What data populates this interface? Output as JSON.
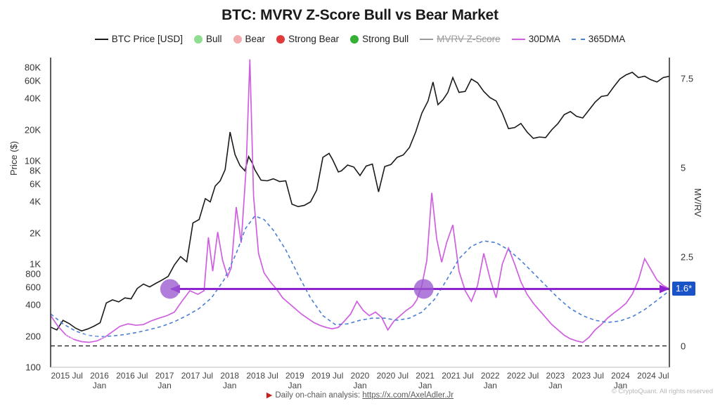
{
  "title": "BTC: MVRV Z-Score Bull vs Bear Market",
  "axis": {
    "left_label": "Price ($)",
    "right_label": "MV/RV",
    "left_ticks": [
      "80K",
      "60K",
      "40K",
      "20K",
      "10K",
      "8K",
      "6K",
      "4K",
      "2K",
      "1K",
      "800",
      "600",
      "400",
      "200",
      "100"
    ],
    "right_ticks": [
      "7.5",
      "5",
      "2.5",
      "0"
    ],
    "x_ticks": [
      "2015 Jul",
      "2016\nJan",
      "2016 Jul",
      "2017\nJan",
      "2017 Jul",
      "2018\nJan",
      "2018 Jul",
      "2019\nJan",
      "2019 Jul",
      "2020\nJan",
      "2020 Jul",
      "2021\nJan",
      "2021 Jul",
      "2022\nJan",
      "2022 Jul",
      "2023\nJan",
      "2023 Jul",
      "2024\nJan",
      "2024 Jul"
    ]
  },
  "legend": [
    {
      "label": "BTC Price [USD]",
      "marker": "line",
      "color": "#1a1a1a",
      "disabled": false
    },
    {
      "label": "Bull",
      "marker": "dot",
      "color": "#90dd90",
      "disabled": false
    },
    {
      "label": "Bear",
      "marker": "dot",
      "color": "#f2aaaa",
      "disabled": false
    },
    {
      "label": "Strong Bear",
      "marker": "dot",
      "color": "#e03a3a",
      "disabled": false
    },
    {
      "label": "Strong Bull",
      "marker": "dot",
      "color": "#35b035",
      "disabled": false
    },
    {
      "label": "MVRV Z-Score",
      "marker": "line",
      "color": "#9a9a9a",
      "disabled": true
    },
    {
      "label": "30DMA",
      "marker": "line",
      "color": "#cf5fe0",
      "disabled": false
    },
    {
      "label": "365DMA",
      "marker": "dash",
      "color": "#4a7fd4",
      "disabled": false
    }
  ],
  "annotations": {
    "current_value_badge": "1.6*",
    "badge_color": "#1a52c8",
    "arrow_color": "#8e24cf",
    "circles": [
      {
        "x_frac": 0.193,
        "value_label": ""
      },
      {
        "x_frac": 0.603,
        "value_label": ""
      }
    ]
  },
  "watermark": "CryptoQuant",
  "footer": {
    "prefix": "Daily on-chain analysis:",
    "link": "https://x.com/AxelAdler.Jr",
    "copyright": "© CryptoQuant. All rights reserved"
  },
  "chart_data": {
    "type": "line",
    "title": "BTC: MVRV Z-Score Bull vs Bear Market",
    "subtitle": "",
    "xlabel": "",
    "ylabel": "Price ($)",
    "y2label": "MV/RV",
    "yscale": "log",
    "ylim": [
      100,
      100000
    ],
    "y2lim": [
      -0.6,
      8.1
    ],
    "grid": true,
    "legend_position": "top-center",
    "x_start": "2015-04",
    "x_end": "2024-08",
    "y_ticks": [
      100,
      200,
      400,
      600,
      800,
      1000,
      2000,
      4000,
      6000,
      8000,
      10000,
      20000,
      40000,
      60000,
      80000
    ],
    "y2_ticks": [
      0,
      2.5,
      5,
      7.5
    ],
    "current_mvrv": 1.6,
    "regime_colors": {
      "bull": "#90dd90",
      "bear": "#f2aaaa",
      "strong_bear": "#e03a3a",
      "strong_bull": "#35b035"
    },
    "regimes": [
      {
        "type": "strong_bear",
        "x0": 0.0,
        "x1": 0.08
      },
      {
        "type": "bull",
        "x0": 0.08,
        "x1": 0.243
      },
      {
        "type": "strong_bull",
        "x0": 0.243,
        "x1": 0.249
      },
      {
        "type": "bull",
        "x0": 0.249,
        "x1": 0.258
      },
      {
        "type": "strong_bull",
        "x0": 0.258,
        "x1": 0.262
      },
      {
        "type": "bull",
        "x0": 0.262,
        "x1": 0.276
      },
      {
        "type": "strong_bull",
        "x0": 0.276,
        "x1": 0.281
      },
      {
        "type": "bull",
        "x0": 0.281,
        "x1": 0.286
      },
      {
        "type": "strong_bull",
        "x0": 0.286,
        "x1": 0.291
      },
      {
        "type": "bull",
        "x0": 0.291,
        "x1": 0.295
      },
      {
        "type": "strong_bull",
        "x0": 0.295,
        "x1": 0.33
      },
      {
        "type": "bear",
        "x0": 0.33,
        "x1": 0.4
      },
      {
        "type": "strong_bear",
        "x0": 0.4,
        "x1": 0.456
      },
      {
        "type": "bear",
        "x0": 0.456,
        "x1": 0.47
      },
      {
        "type": "bull",
        "x0": 0.47,
        "x1": 0.522
      },
      {
        "type": "bear",
        "x0": 0.522,
        "x1": 0.531
      },
      {
        "type": "bull",
        "x0": 0.531,
        "x1": 0.537
      },
      {
        "type": "bear",
        "x0": 0.537,
        "x1": 0.56
      },
      {
        "type": "bull",
        "x0": 0.56,
        "x1": 0.601
      },
      {
        "type": "strong_bull",
        "x0": 0.601,
        "x1": 0.607
      },
      {
        "type": "bull",
        "x0": 0.607,
        "x1": 0.611
      },
      {
        "type": "strong_bull",
        "x0": 0.611,
        "x1": 0.64
      },
      {
        "type": "bull",
        "x0": 0.64,
        "x1": 0.648
      },
      {
        "type": "bear",
        "x0": 0.648,
        "x1": 0.755
      },
      {
        "type": "strong_bear",
        "x0": 0.755,
        "x1": 0.766
      },
      {
        "type": "bear",
        "x0": 0.766,
        "x1": 0.77
      },
      {
        "type": "strong_bear",
        "x0": 0.77,
        "x1": 0.812
      },
      {
        "type": "bear",
        "x0": 0.812,
        "x1": 0.822
      },
      {
        "type": "strong_bear",
        "x0": 0.822,
        "x1": 0.826
      },
      {
        "type": "bull",
        "x0": 0.826,
        "x1": 1.0
      }
    ],
    "series": [
      {
        "name": "BTC Price [USD]",
        "axis": "left",
        "color": "#1a1a1a",
        "style": "solid-filled",
        "x": [
          0.0,
          0.01,
          0.02,
          0.03,
          0.04,
          0.05,
          0.06,
          0.07,
          0.08,
          0.09,
          0.1,
          0.11,
          0.12,
          0.13,
          0.14,
          0.15,
          0.16,
          0.17,
          0.18,
          0.19,
          0.2,
          0.21,
          0.22,
          0.23,
          0.24,
          0.25,
          0.258,
          0.266,
          0.274,
          0.282,
          0.29,
          0.298,
          0.306,
          0.314,
          0.32,
          0.326,
          0.33,
          0.34,
          0.35,
          0.36,
          0.37,
          0.38,
          0.39,
          0.4,
          0.41,
          0.42,
          0.43,
          0.44,
          0.45,
          0.456,
          0.465,
          0.47,
          0.48,
          0.49,
          0.5,
          0.51,
          0.52,
          0.53,
          0.54,
          0.55,
          0.56,
          0.57,
          0.58,
          0.59,
          0.6,
          0.61,
          0.618,
          0.626,
          0.634,
          0.642,
          0.65,
          0.66,
          0.67,
          0.68,
          0.69,
          0.7,
          0.71,
          0.72,
          0.73,
          0.74,
          0.75,
          0.76,
          0.77,
          0.78,
          0.79,
          0.8,
          0.81,
          0.82,
          0.83,
          0.84,
          0.85,
          0.86,
          0.87,
          0.88,
          0.89,
          0.9,
          0.91,
          0.92,
          0.93,
          0.94,
          0.95,
          0.96,
          0.97,
          0.98,
          0.99,
          1.0
        ],
        "y": [
          245,
          230,
          285,
          265,
          240,
          225,
          235,
          250,
          270,
          420,
          450,
          430,
          470,
          460,
          580,
          640,
          600,
          650,
          700,
          760,
          980,
          1180,
          1050,
          2500,
          2700,
          4300,
          4000,
          5700,
          6400,
          8200,
          19000,
          11500,
          9000,
          8000,
          11000,
          9500,
          8200,
          6500,
          6400,
          6700,
          6300,
          6400,
          3800,
          3600,
          3700,
          4000,
          5200,
          10800,
          11800,
          10200,
          7800,
          8000,
          9100,
          8700,
          7200,
          8900,
          9300,
          5000,
          8800,
          9200,
          10800,
          11400,
          13500,
          19000,
          29000,
          38000,
          58000,
          35000,
          39000,
          46000,
          64000,
          46000,
          47000,
          62000,
          57000,
          47000,
          41000,
          38000,
          29000,
          20500,
          21000,
          23000,
          19000,
          16500,
          17000,
          16800,
          20000,
          23000,
          28000,
          30000,
          27000,
          26000,
          31000,
          37000,
          42000,
          43000,
          52000,
          62000,
          68000,
          72000,
          64000,
          66000,
          61000,
          58000,
          64000,
          66000
        ]
      },
      {
        "name": "30DMA",
        "axis": "right",
        "color": "#cf5fe0",
        "style": "solid",
        "x": [
          0.0,
          0.012,
          0.025,
          0.038,
          0.05,
          0.062,
          0.075,
          0.088,
          0.1,
          0.112,
          0.125,
          0.138,
          0.15,
          0.162,
          0.175,
          0.188,
          0.2,
          0.212,
          0.225,
          0.238,
          0.248,
          0.255,
          0.262,
          0.27,
          0.278,
          0.286,
          0.292,
          0.3,
          0.308,
          0.316,
          0.322,
          0.328,
          0.336,
          0.345,
          0.355,
          0.365,
          0.375,
          0.385,
          0.395,
          0.405,
          0.415,
          0.425,
          0.435,
          0.445,
          0.455,
          0.465,
          0.475,
          0.485,
          0.495,
          0.505,
          0.515,
          0.525,
          0.535,
          0.545,
          0.555,
          0.565,
          0.575,
          0.585,
          0.592,
          0.6,
          0.608,
          0.616,
          0.624,
          0.632,
          0.64,
          0.65,
          0.66,
          0.67,
          0.68,
          0.69,
          0.7,
          0.71,
          0.72,
          0.73,
          0.74,
          0.75,
          0.76,
          0.77,
          0.78,
          0.79,
          0.8,
          0.81,
          0.82,
          0.83,
          0.84,
          0.85,
          0.86,
          0.87,
          0.88,
          0.89,
          0.9,
          0.91,
          0.92,
          0.93,
          0.94,
          0.95,
          0.96,
          0.97,
          0.98,
          0.99,
          1.0
        ],
        "y": [
          0.85,
          0.55,
          0.3,
          0.18,
          0.12,
          0.1,
          0.14,
          0.25,
          0.4,
          0.55,
          0.62,
          0.58,
          0.6,
          0.7,
          0.78,
          0.85,
          0.95,
          1.25,
          1.55,
          1.45,
          1.55,
          3.05,
          2.1,
          3.2,
          2.4,
          1.95,
          2.2,
          3.9,
          2.9,
          5.0,
          8.05,
          4.2,
          2.6,
          2.05,
          1.8,
          1.6,
          1.35,
          1.2,
          1.05,
          0.9,
          0.78,
          0.66,
          0.58,
          0.52,
          0.48,
          0.52,
          0.7,
          0.9,
          1.25,
          1.0,
          0.85,
          0.95,
          0.8,
          0.45,
          0.7,
          0.85,
          1.0,
          1.12,
          1.3,
          1.7,
          2.4,
          4.3,
          3.0,
          2.35,
          2.9,
          3.4,
          2.1,
          1.55,
          1.25,
          1.7,
          2.6,
          1.9,
          1.35,
          2.3,
          2.75,
          2.3,
          1.8,
          1.45,
          1.2,
          1.0,
          0.8,
          0.6,
          0.45,
          0.3,
          0.2,
          0.14,
          0.1,
          0.24,
          0.45,
          0.6,
          0.78,
          0.92,
          1.05,
          1.2,
          1.45,
          1.85,
          2.45,
          2.15,
          1.85,
          1.7,
          1.6
        ]
      },
      {
        "name": "365DMA",
        "axis": "right",
        "color": "#4a7fd4",
        "style": "dashed",
        "x": [
          0.0,
          0.02,
          0.04,
          0.06,
          0.08,
          0.1,
          0.12,
          0.14,
          0.16,
          0.18,
          0.2,
          0.22,
          0.24,
          0.26,
          0.28,
          0.3,
          0.315,
          0.33,
          0.345,
          0.36,
          0.38,
          0.4,
          0.42,
          0.44,
          0.46,
          0.48,
          0.5,
          0.52,
          0.54,
          0.56,
          0.58,
          0.6,
          0.62,
          0.64,
          0.66,
          0.68,
          0.7,
          0.72,
          0.74,
          0.76,
          0.78,
          0.8,
          0.82,
          0.84,
          0.86,
          0.88,
          0.9,
          0.92,
          0.94,
          0.96,
          0.98,
          1.0
        ],
        "y": [
          0.9,
          0.62,
          0.42,
          0.3,
          0.26,
          0.28,
          0.32,
          0.38,
          0.46,
          0.55,
          0.68,
          0.85,
          1.05,
          1.35,
          1.85,
          2.6,
          3.3,
          3.65,
          3.55,
          3.25,
          2.7,
          2.0,
          1.35,
          0.85,
          0.6,
          0.62,
          0.72,
          0.78,
          0.78,
          0.72,
          0.78,
          0.95,
          1.3,
          1.85,
          2.45,
          2.8,
          2.95,
          2.9,
          2.7,
          2.4,
          2.05,
          1.7,
          1.35,
          1.05,
          0.85,
          0.72,
          0.66,
          0.7,
          0.82,
          1.02,
          1.28,
          1.55
        ]
      }
    ],
    "zero_line": {
      "value": 0,
      "axis": "right",
      "style": "dashed",
      "color": "#222222"
    },
    "annotation_arrow": {
      "y_value": 1.6,
      "x0_frac": 0.193,
      "x1_frac": 1.0,
      "color": "#8e24cf",
      "double_headed": true
    }
  }
}
